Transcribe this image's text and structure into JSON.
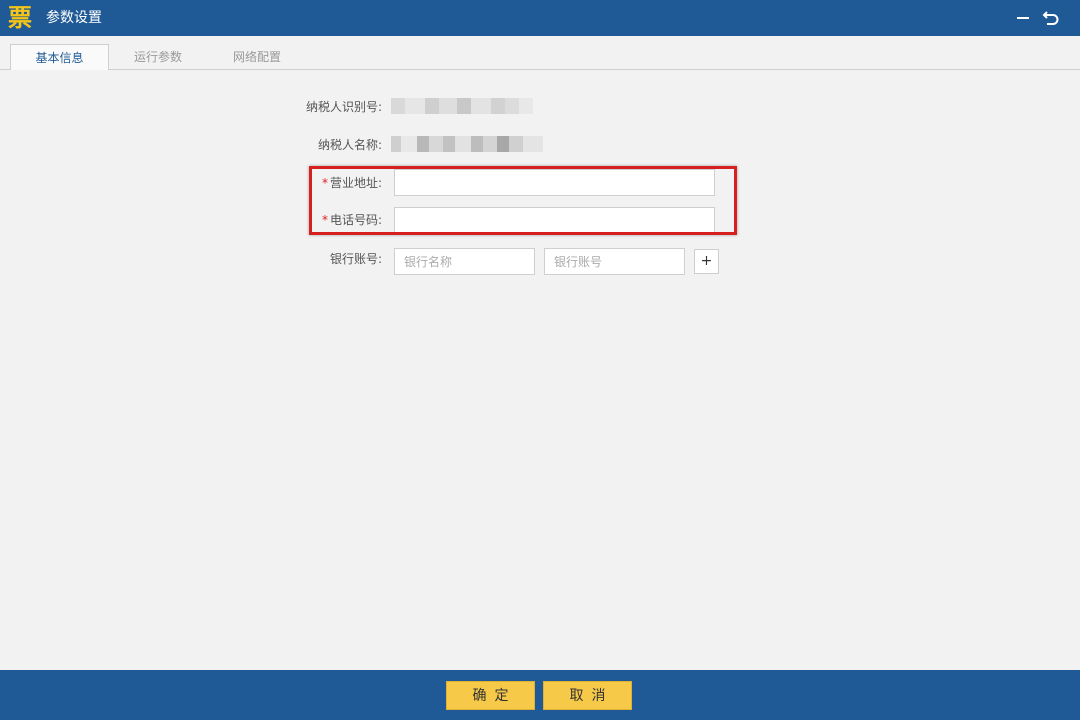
{
  "window": {
    "logo_glyph": "票",
    "title": "参数设置",
    "minimize_icon": "minimize-icon",
    "back_icon": "return-arrow-icon"
  },
  "tabs": [
    {
      "label": "基本信息",
      "active": true
    },
    {
      "label": "运行参数",
      "active": false
    },
    {
      "label": "网络配置",
      "active": false
    }
  ],
  "form": {
    "taxpayer_id_label": "纳税人识别号:",
    "taxpayer_name_label": "纳税人名称:",
    "address_label": "营业地址:",
    "phone_label": "电话号码:",
    "required_mark": "*",
    "address_value": "",
    "phone_value": "",
    "bank_label": "银行账号:",
    "bank_name_placeholder": "银行名称",
    "bank_account_placeholder": "银行账号",
    "add_label": "+"
  },
  "footer": {
    "ok_label": "确定",
    "cancel_label": "取消"
  },
  "colors": {
    "titlebar": "#1f5a96",
    "accent_button": "#f7c948",
    "highlight": "#d61f1f",
    "required": "#e02020"
  }
}
